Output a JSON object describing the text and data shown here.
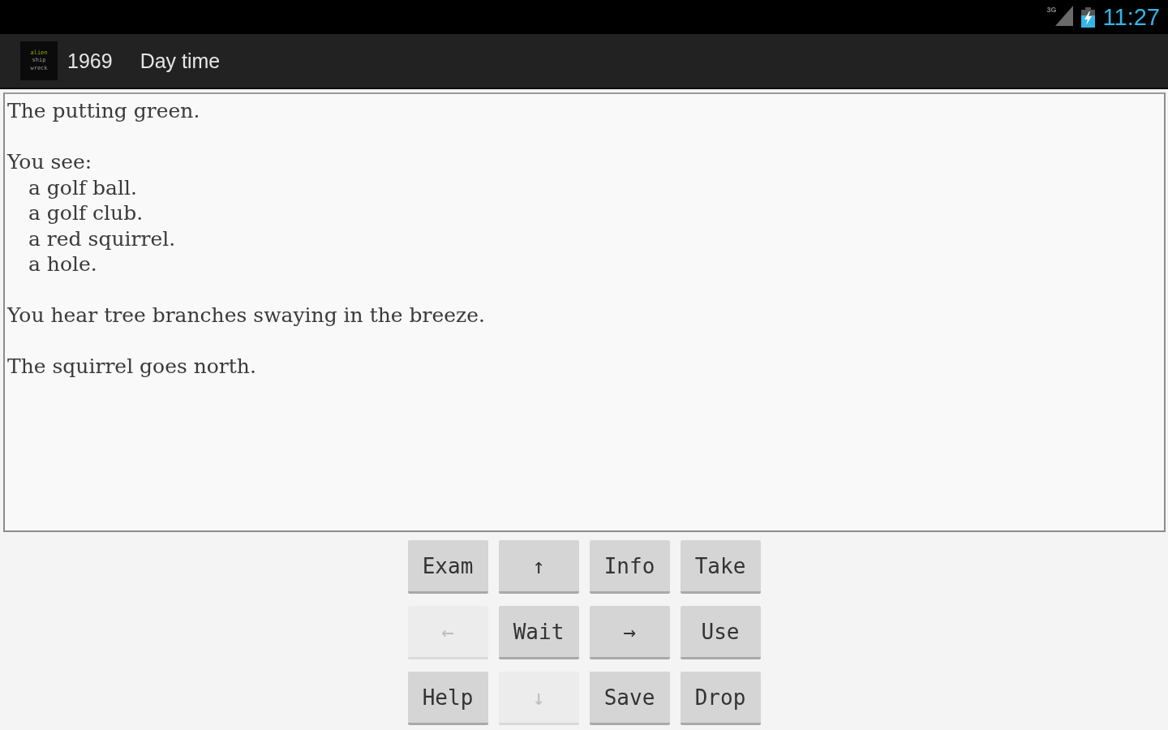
{
  "status_bar": {
    "network": "3G",
    "time": "11:27"
  },
  "action_bar": {
    "logo_lines": [
      "alien",
      "ship",
      "wreck"
    ],
    "year": "1969",
    "subtitle": "Day time"
  },
  "output": {
    "paragraphs": [
      {
        "text": "The putting green."
      },
      {
        "text": "You see:",
        "items": [
          "a golf ball.",
          "a golf club.",
          "a red squirrel.",
          "a hole."
        ]
      },
      {
        "text": "You hear tree branches swaying in the breeze."
      },
      {
        "text": "The squirrel goes north."
      }
    ]
  },
  "buttons": [
    {
      "label": "Exam",
      "disabled": false
    },
    {
      "label": "↑",
      "disabled": false
    },
    {
      "label": "Info",
      "disabled": false
    },
    {
      "label": "Take",
      "disabled": false
    },
    {
      "label": "←",
      "disabled": true
    },
    {
      "label": "Wait",
      "disabled": false
    },
    {
      "label": "→",
      "disabled": false
    },
    {
      "label": "Use",
      "disabled": false
    },
    {
      "label": "Help",
      "disabled": false
    },
    {
      "label": "↓",
      "disabled": true
    },
    {
      "label": "Save",
      "disabled": false
    },
    {
      "label": "Drop",
      "disabled": false
    }
  ]
}
